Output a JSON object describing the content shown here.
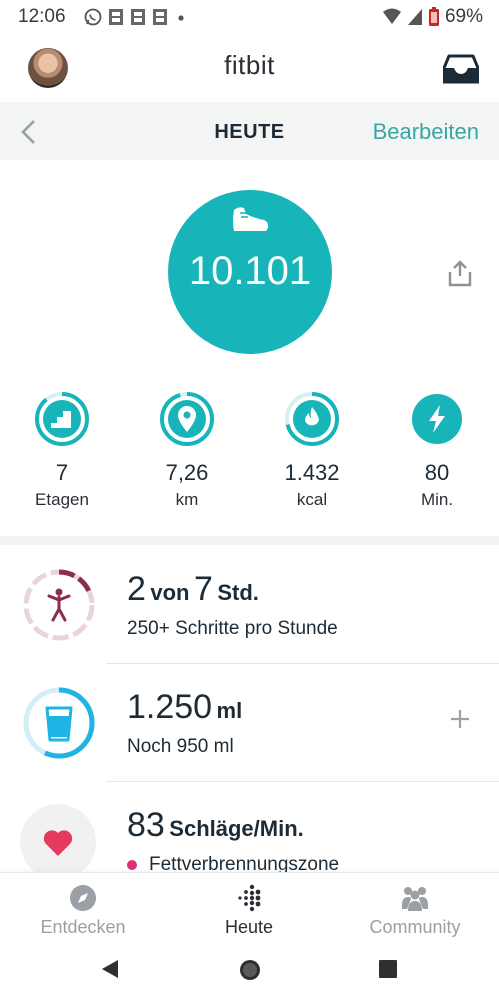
{
  "status_bar": {
    "time": "12:06",
    "battery": "69%",
    "notification_icons": [
      "whatsapp-icon",
      "app-notification-icon",
      "app-notification-icon",
      "app-notification-icon",
      "dot-icon"
    ]
  },
  "app_bar": {
    "title": "fitbit"
  },
  "sub_header": {
    "title": "HEUTE",
    "edit_label": "Bearbeiten"
  },
  "hero": {
    "steps": "10.101"
  },
  "stats": [
    {
      "icon": "stairs-icon",
      "value": "7",
      "unit": "Etagen"
    },
    {
      "icon": "location-pin-icon",
      "value": "7,26",
      "unit": "km"
    },
    {
      "icon": "flame-icon",
      "value": "1.432",
      "unit": "kcal"
    },
    {
      "icon": "lightning-icon",
      "value": "80",
      "unit": "Min."
    }
  ],
  "tiles": {
    "hourly": {
      "value": "2",
      "mid": "von",
      "goal": "7",
      "unit": "Std.",
      "sub": "250+ Schritte pro Stunde",
      "progress_hours": 2,
      "goal_hours": 7
    },
    "water": {
      "value": "1.250",
      "unit": "ml",
      "sub": "Noch 950 ml",
      "consumed_ml": 1250,
      "remaining_ml": 950
    },
    "heart": {
      "value": "83",
      "unit": "Schläge/Min.",
      "sub": "Fettverbrennungszone"
    }
  },
  "bottom_nav": [
    {
      "id": "discover",
      "icon": "compass-icon",
      "label": "Entdecken",
      "active": false
    },
    {
      "id": "today",
      "icon": "fitbit-logo-icon",
      "label": "Heute",
      "active": true
    },
    {
      "id": "community",
      "icon": "community-icon",
      "label": "Community",
      "active": false
    }
  ],
  "colors": {
    "accent": "#17b5b9",
    "link": "#39a6a4",
    "hourly": "#8b2e4a",
    "water": "#1fb4e3",
    "heart": "#e53a5b",
    "zone": "#e0307a"
  }
}
